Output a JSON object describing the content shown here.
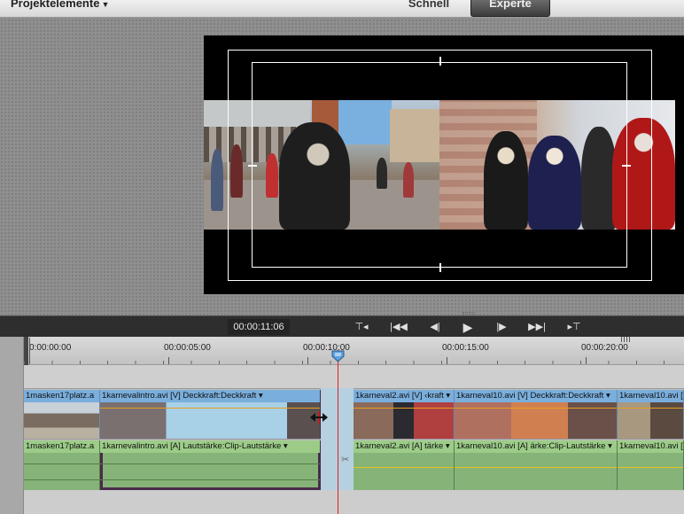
{
  "topbar": {
    "project_menu": "Projektelemente",
    "mode_quick": "Schnell",
    "mode_expert": "Experte"
  },
  "transport": {
    "timecode": "00:00:11:06",
    "buttons": [
      "set-in",
      "go-to-start",
      "step-back",
      "play",
      "step-forward",
      "go-to-end",
      "set-out"
    ]
  },
  "ruler": {
    "labels": [
      "0:00:00:00",
      "00:00:05:00",
      "00:00:10:00",
      "00:00:15:00",
      "00:00:20:00"
    ]
  },
  "timeline": {
    "video_clips": [
      {
        "name": "1masken17platz.a",
        "effect": ""
      },
      {
        "name": "1karnevalintro.avi [V]",
        "effect": "Deckkraft:Deckkraft ▾"
      },
      {
        "name": "1karneval2.avi [V]",
        "effect": "‹kraft ▾"
      },
      {
        "name": "1karneval10.avi [V]",
        "effect": "Deckkraft:Deckkraft ▾"
      },
      {
        "name": "1karneval10.avi [",
        "effect": ""
      }
    ],
    "audio_clips": [
      {
        "name": "1masken17platz.a",
        "effect": ""
      },
      {
        "name": "1karnevalintro.avi [A]",
        "effect": "Lautstärke:Clip-Lautstärke ▾"
      },
      {
        "name": "1karneval2.avi [A]",
        "effect": "tärke ▾"
      },
      {
        "name": "1karneval10.avi [A]",
        "effect": "ärke:Clip-Lautstärke ▾"
      },
      {
        "name": "1karneval10.avi [",
        "effect": ""
      }
    ]
  },
  "colors": {
    "video_clip": "#a4c8e4",
    "audio_clip": "#86b478",
    "playhead": "#e02020",
    "selected_outline": "#4a2a4a"
  }
}
